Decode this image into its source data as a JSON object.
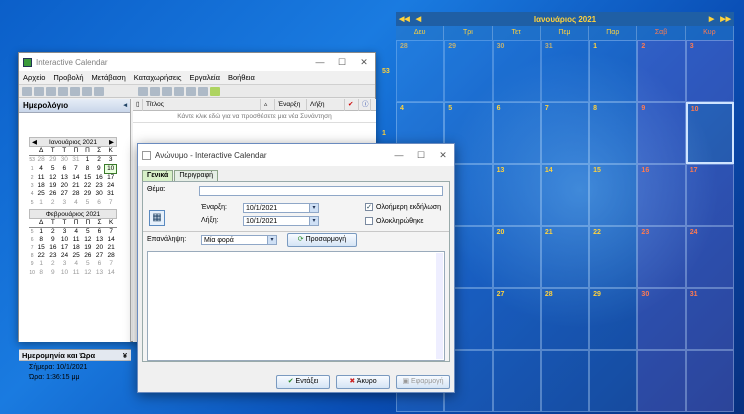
{
  "desktop_calendar": {
    "title": "Ιανουάριος 2021",
    "nav_prev_year": "◀◀",
    "nav_prev": "◀",
    "nav_next": "▶",
    "nav_next_year": "▶▶",
    "weekdays": [
      "Δευ",
      "Τρι",
      "Τετ",
      "Πεμ",
      "Παρ",
      "Σαβ",
      "Κυρ"
    ],
    "week_numbers": [
      "53",
      "1"
    ],
    "weeks": [
      [
        "28",
        "29",
        "30",
        "31",
        "1",
        "2",
        "3"
      ],
      [
        "4",
        "5",
        "6",
        "7",
        "8",
        "9",
        "10"
      ],
      [
        "",
        "",
        "13",
        "14",
        "15",
        "16",
        "17"
      ],
      [
        "",
        "",
        "20",
        "21",
        "22",
        "23",
        "24"
      ],
      [
        "",
        "",
        "27",
        "28",
        "29",
        "30",
        "31"
      ],
      [
        "",
        "",
        "",
        "",
        "",
        "",
        ""
      ]
    ],
    "today": "10"
  },
  "window": {
    "title": "Interactive Calendar",
    "menu": [
      "Αρχείο",
      "Προβολή",
      "Μετάβαση",
      "Καταχωρήσεις",
      "Εργαλεία",
      "Βοήθεια"
    ],
    "left_header": "Ημερολόγιο",
    "mini1": {
      "title": "Ιανουάριος 2021",
      "days": [
        "Δ",
        "Τ",
        "Τ",
        "Π",
        "Π",
        "Σ",
        "Κ"
      ],
      "rows": [
        [
          "53",
          "28",
          "29",
          "30",
          "31",
          "1",
          "2",
          "3"
        ],
        [
          "1",
          "4",
          "5",
          "6",
          "7",
          "8",
          "9",
          "10"
        ],
        [
          "2",
          "11",
          "12",
          "13",
          "14",
          "15",
          "16",
          "17"
        ],
        [
          "3",
          "18",
          "19",
          "20",
          "21",
          "22",
          "23",
          "24"
        ],
        [
          "4",
          "25",
          "26",
          "27",
          "28",
          "29",
          "30",
          "31"
        ],
        [
          "5",
          "1",
          "2",
          "3",
          "4",
          "5",
          "6",
          "7"
        ]
      ]
    },
    "mini2": {
      "title": "Φεβρουάριος 2021",
      "days": [
        "Δ",
        "Τ",
        "Τ",
        "Π",
        "Π",
        "Σ",
        "Κ"
      ],
      "rows": [
        [
          "5",
          "1",
          "2",
          "3",
          "4",
          "5",
          "6",
          "7"
        ],
        [
          "6",
          "8",
          "9",
          "10",
          "11",
          "12",
          "13",
          "14"
        ],
        [
          "7",
          "15",
          "16",
          "17",
          "18",
          "19",
          "20",
          "21"
        ],
        [
          "8",
          "22",
          "23",
          "24",
          "25",
          "26",
          "27",
          "28"
        ],
        [
          "9",
          "1",
          "2",
          "3",
          "4",
          "5",
          "6",
          "7"
        ],
        [
          "10",
          "8",
          "9",
          "10",
          "11",
          "12",
          "13",
          "14"
        ]
      ]
    },
    "datetime_header": "Ημερομηνία και Ώρα",
    "today_line": "Σήμερα: 10/1/2021",
    "time_line": "Ώρα: 1:36:15 μμ",
    "columns": [
      "Τίτλος",
      "Έναρξη",
      "Λήξη"
    ],
    "add_hint": "Κάντε κλικ εδώ για να προσθέσετε μια νέα Συνάντηση"
  },
  "dialog": {
    "title": "Ανώνυμο - Interactive Calendar",
    "tabs": [
      "Γενικά",
      "Περιγραφή"
    ],
    "subject_label": "Θέμα:",
    "subject_value": "",
    "start_label": "Έναρξη:",
    "start_value": "10/1/2021",
    "end_label": "Λήξη:",
    "end_value": "10/1/2021",
    "allday_label": "Ολοήμερη εκδήλωση",
    "completed_label": "Ολοκληρώθηκε",
    "repeat_label": "Επανάληψη:",
    "repeat_value": "Μία φορά",
    "customize_label": "Προσαρμογή",
    "ok_label": "Εντάξει",
    "cancel_label": "Άκυρο",
    "apply_label": "Εφαρμογή"
  }
}
